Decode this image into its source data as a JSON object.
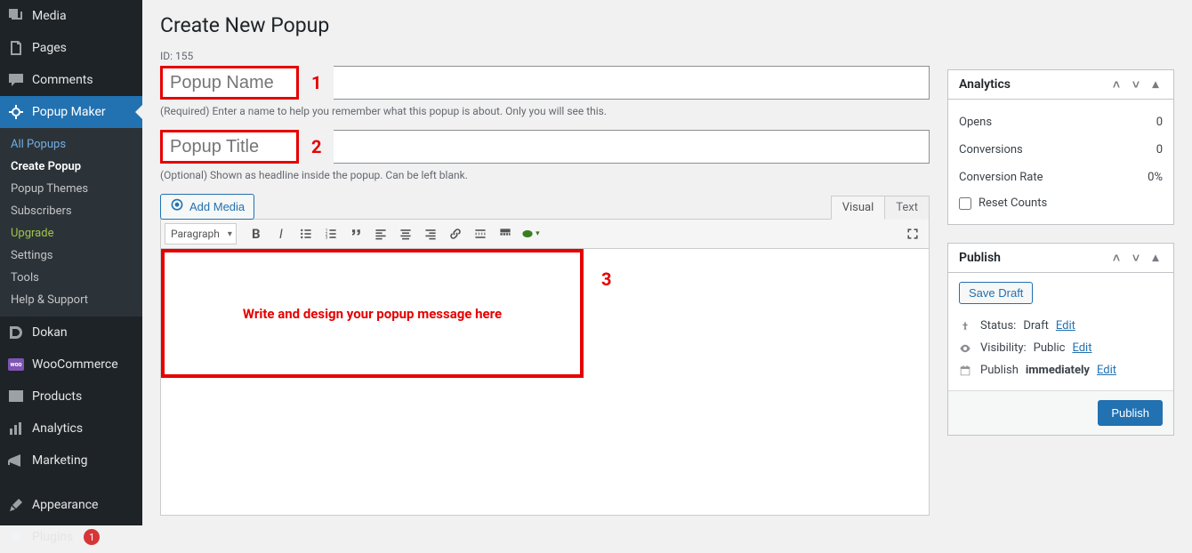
{
  "sidebar": {
    "items": [
      {
        "label": "Media"
      },
      {
        "label": "Pages"
      },
      {
        "label": "Comments"
      },
      {
        "label": "Popup Maker"
      },
      {
        "label": "Dokan"
      },
      {
        "label": "WooCommerce"
      },
      {
        "label": "Products"
      },
      {
        "label": "Analytics"
      },
      {
        "label": "Marketing"
      },
      {
        "label": "Appearance"
      },
      {
        "label": "Plugins",
        "badge": "1"
      }
    ],
    "sub": {
      "all": "All Popups",
      "create": "Create Popup",
      "themes": "Popup Themes",
      "subscribers": "Subscribers",
      "upgrade": "Upgrade",
      "settings": "Settings",
      "tools": "Tools",
      "help": "Help & Support"
    }
  },
  "page": {
    "title": "Create New Popup",
    "id_label": "ID: 155",
    "name_placeholder": "Popup Name",
    "name_help": "(Required) Enter a name to help you remember what this popup is about. Only you will see this.",
    "title_placeholder": "Popup Title",
    "title_help": "(Optional) Shown as headline inside the popup. Can be left blank."
  },
  "annotations": {
    "one": "1",
    "two": "2",
    "three": "3",
    "editor_msg": "Write and design your popup message here"
  },
  "editor": {
    "add_media": "Add Media",
    "tab_visual": "Visual",
    "tab_text": "Text",
    "format_select": "Paragraph"
  },
  "analytics": {
    "title": "Analytics",
    "opens_label": "Opens",
    "opens_value": "0",
    "conv_label": "Conversions",
    "conv_value": "0",
    "rate_label": "Conversion Rate",
    "rate_value": "0%",
    "reset": "Reset Counts"
  },
  "publish": {
    "title": "Publish",
    "save_draft": "Save Draft",
    "status_pre": "Status:",
    "status_val": "Draft",
    "vis_pre": "Visibility:",
    "vis_val": "Public",
    "pub_pre": "Publish",
    "pub_val": "immediately",
    "edit": "Edit",
    "button": "Publish"
  }
}
